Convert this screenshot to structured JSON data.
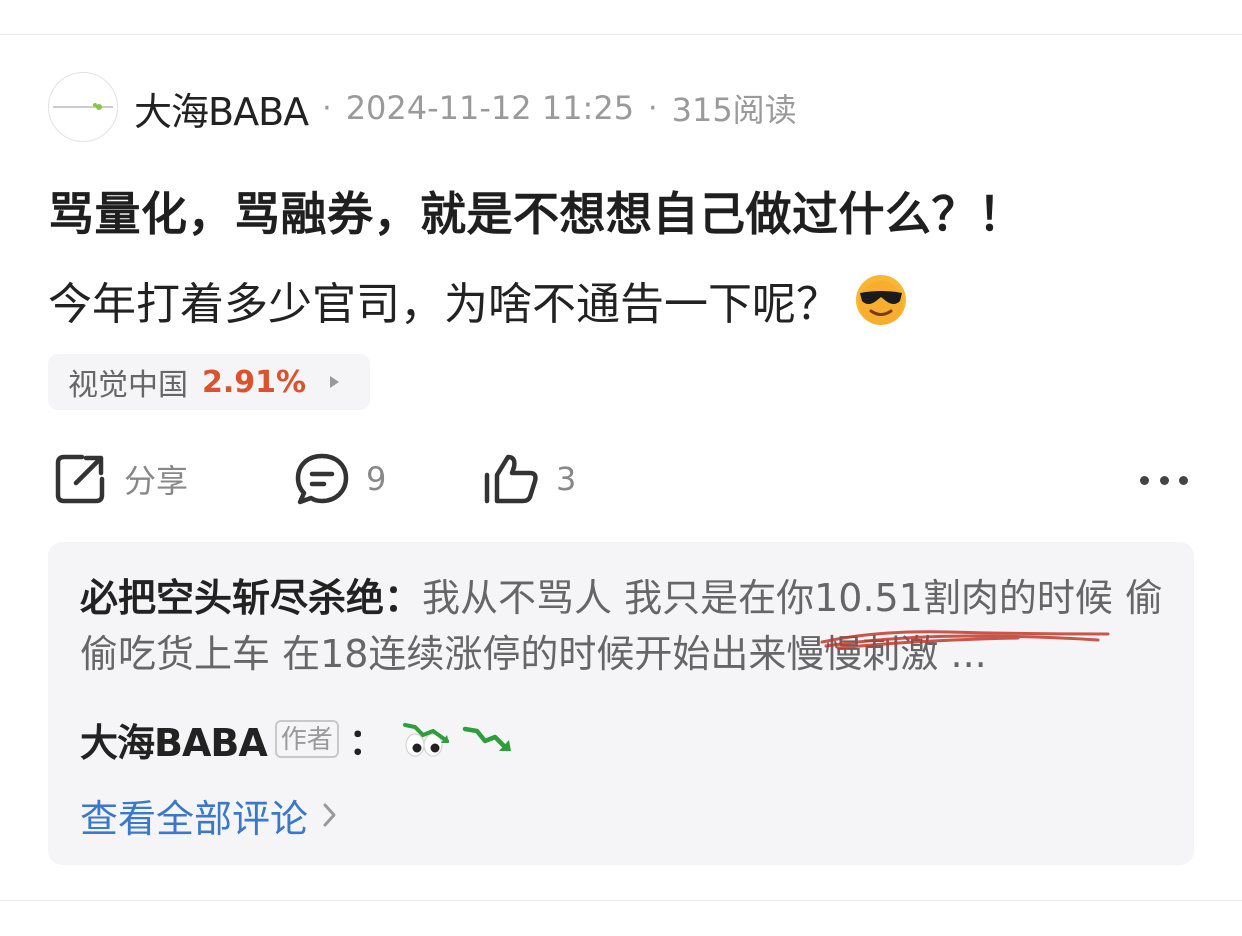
{
  "post": {
    "author": "大海BABA",
    "date": "2024-11-12 11:25",
    "reads": "315阅读",
    "title": "骂量化，骂融券，就是不想想自己做过什么？！",
    "body": "今年打着多少官司，为啥不通告一下呢？",
    "body_emoji": "sunglasses-emoji"
  },
  "stock": {
    "name": "视觉中国",
    "change": "2.91%",
    "change_color": "#d9542c"
  },
  "actions": {
    "share_label": "分享",
    "comment_count": "9",
    "like_count": "3"
  },
  "comments": {
    "top_author": "必把空头斩尽杀绝",
    "top_separator": "：",
    "top_text": "我从不骂人 我只是在你10.51割肉的时候 偷偷吃货上车 在18连续涨停的时候开始出来慢慢刺激 ...",
    "reply_author": "大海BABA",
    "reply_badge": "作者",
    "reply_separator": "：",
    "reply_emojis": [
      "eyes-emoji",
      "chart-decreasing-emoji"
    ],
    "view_all": "查看全部评论"
  },
  "colors": {
    "link": "#3a78c9",
    "annotation_red": "#c0392b"
  }
}
